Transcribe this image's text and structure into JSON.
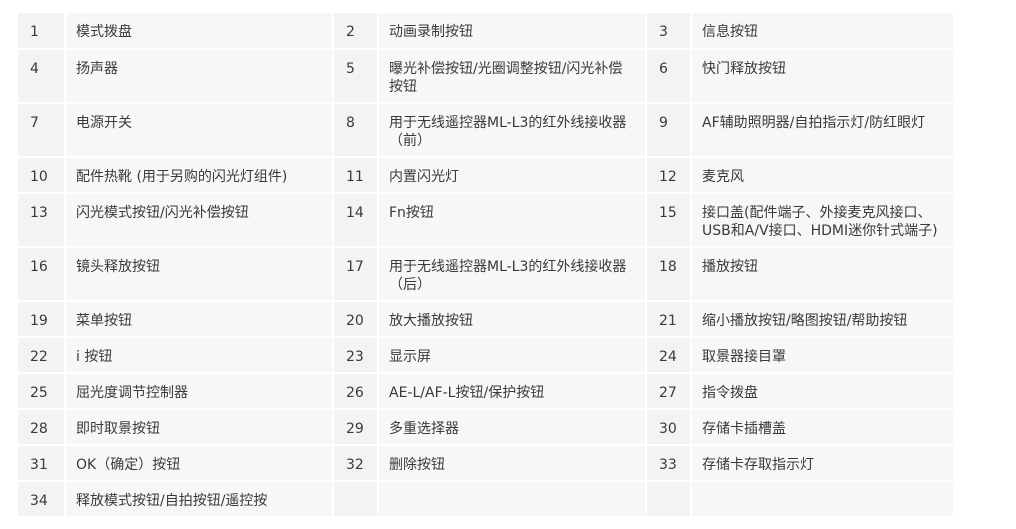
{
  "rows": [
    [
      [
        "1",
        "模式拨盘"
      ],
      [
        "2",
        "动画录制按钮"
      ],
      [
        "3",
        "信息按钮"
      ]
    ],
    [
      [
        "4",
        "扬声器"
      ],
      [
        "5",
        "曝光补偿按钮/光圈调整按钮/闪光补偿按钮"
      ],
      [
        "6",
        "快门释放按钮"
      ]
    ],
    [
      [
        "7",
        "电源开关"
      ],
      [
        "8",
        "用于无线遥控器ML-L3的红外线接收器（前）"
      ],
      [
        "9",
        "AF辅助照明器/自拍指示灯/防红眼灯"
      ]
    ],
    [
      [
        "10",
        "配件热靴 (用于另购的闪光灯组件)"
      ],
      [
        "11",
        "内置闪光灯"
      ],
      [
        "12",
        "麦克风"
      ]
    ],
    [
      [
        "13",
        "闪光模式按钮/闪光补偿按钮"
      ],
      [
        "14",
        "Fn按钮"
      ],
      [
        "15",
        "接口盖(配件端子、外接麦克风接口、USB和A/V接口、HDMI迷你针式端子)"
      ]
    ],
    [
      [
        "16",
        "镜头释放按钮"
      ],
      [
        "17",
        "用于无线遥控器ML-L3的红外线接收器（后）"
      ],
      [
        "18",
        "播放按钮"
      ]
    ],
    [
      [
        "19",
        "菜单按钮"
      ],
      [
        "20",
        "放大播放按钮"
      ],
      [
        "21",
        "缩小播放按钮/略图按钮/帮助按钮"
      ]
    ],
    [
      [
        "22",
        "i 按钮"
      ],
      [
        "23",
        "显示屏"
      ],
      [
        "24",
        "取景器接目罩"
      ]
    ],
    [
      [
        "25",
        "屈光度调节控制器"
      ],
      [
        "26",
        "AE-L/AF-L按钮/保护按钮"
      ],
      [
        "27",
        "指令拨盘"
      ]
    ],
    [
      [
        "28",
        "即时取景按钮"
      ],
      [
        "29",
        "多重选择器"
      ],
      [
        "30",
        "存储卡插槽盖"
      ]
    ],
    [
      [
        "31",
        "OK（确定）按钮"
      ],
      [
        "32",
        "删除按钮"
      ],
      [
        "33",
        "存储卡存取指示灯"
      ]
    ],
    [
      [
        "34",
        "释放模式按钮/自拍按钮/遥控按"
      ],
      [
        "",
        ""
      ],
      [
        "",
        ""
      ]
    ]
  ]
}
